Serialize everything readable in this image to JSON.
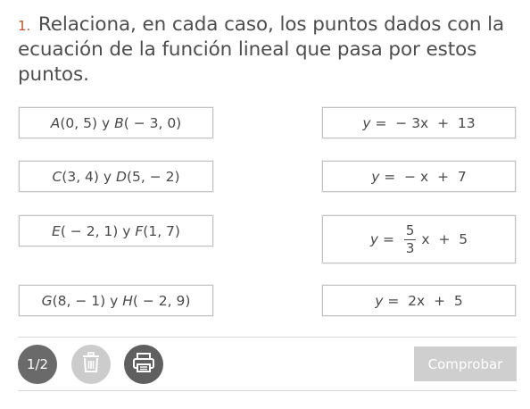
{
  "question": {
    "number": "1.",
    "text": "Relaciona, en cada caso, los puntos dados con la ecuación de la función lineal que pasa por estos puntos."
  },
  "points": [
    {
      "p1_name": "A",
      "p1_coords": "(0, 5)",
      "joiner": " y ",
      "p2_name": "B",
      "p2_coords": "( − 3, 0)"
    },
    {
      "p1_name": "C",
      "p1_coords": "(3, 4)",
      "joiner": " y ",
      "p2_name": "D",
      "p2_coords": "(5,  − 2)"
    },
    {
      "p1_name": "E",
      "p1_coords": "( − 2, 1)",
      "joiner": " y ",
      "p2_name": "F",
      "p2_coords": "(1, 7)"
    },
    {
      "p1_name": "G",
      "p1_coords": "(8,  − 1)",
      "joiner": " y ",
      "p2_name": "H",
      "p2_coords": "( − 2, 9)"
    }
  ],
  "equations": [
    {
      "var": "y",
      "rhs": " =  − 3x  +  13"
    },
    {
      "var": "y",
      "rhs": " =  − x  +  7"
    },
    {
      "var": "y",
      "eq": " = ",
      "num": "5",
      "den": "3",
      "tail": "x  +  5"
    },
    {
      "var": "y",
      "rhs": " =  2x  +  5"
    }
  ],
  "footer": {
    "page": "1/2",
    "check_label": "Comprobar",
    "trash_icon": "trash-icon",
    "print_icon": "printer-icon"
  },
  "colors": {
    "question_number": "#c0522d",
    "box_border": "#c3c3c3",
    "check_button_bg": "#cfcfcf",
    "page_indicator_bg": "#6a6a6a"
  }
}
